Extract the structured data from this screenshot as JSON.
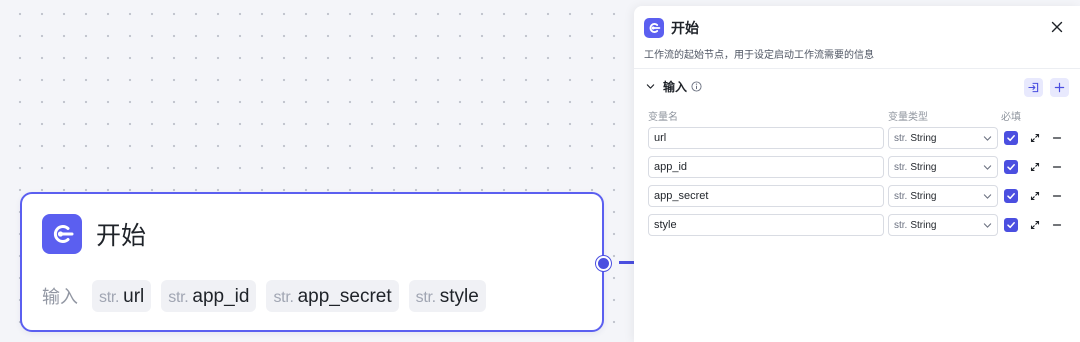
{
  "node": {
    "title": "开始",
    "inputs_label": "输入",
    "params": [
      {
        "type": "str.",
        "name": "url"
      },
      {
        "type": "str.",
        "name": "app_id"
      },
      {
        "type": "str.",
        "name": "app_secret"
      },
      {
        "type": "str.",
        "name": "style"
      }
    ]
  },
  "panel": {
    "title": "开始",
    "description": "工作流的起始节点，用于设定启动工作流需要的信息",
    "section_title": "输入",
    "columns": {
      "name": "变量名",
      "type": "变量类型",
      "required": "必填"
    },
    "rows": [
      {
        "name": "url",
        "type_prefix": "str.",
        "type": "String",
        "required": true
      },
      {
        "name": "app_id",
        "type_prefix": "str.",
        "type": "String",
        "required": true
      },
      {
        "name": "app_secret",
        "type_prefix": "str.",
        "type": "String",
        "required": true
      },
      {
        "name": "style",
        "type_prefix": "str.",
        "type": "String",
        "required": true
      }
    ]
  },
  "colors": {
    "accent": "#5b5ff0",
    "connector": "#4b4fe0",
    "canvas": "#f4f5f9"
  },
  "icons": [
    "start-node-icon",
    "close-icon",
    "chevron-down-icon",
    "info-icon",
    "import-icon",
    "plus-icon",
    "check-icon",
    "expand-icon",
    "minus-icon"
  ]
}
